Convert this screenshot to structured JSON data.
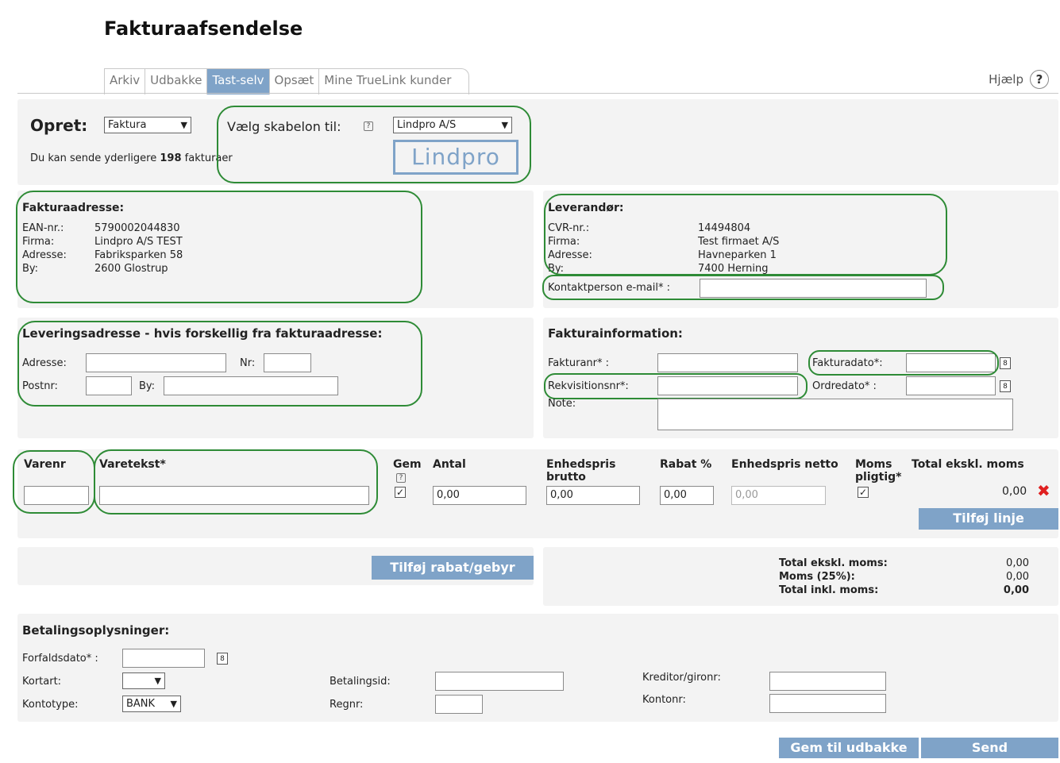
{
  "page": {
    "title": "Fakturaafsendelse"
  },
  "tabs": [
    "Arkiv",
    "Udbakke",
    "Tast-selv",
    "Opsæt",
    "Mine TrueLink kunder"
  ],
  "help": {
    "label": "Hjælp",
    "icon": "?"
  },
  "opret": {
    "label": "Opret:",
    "type_selected": "Faktura",
    "template_label": "Vælg skabelon til:",
    "template_selected": "Lindpro A/S",
    "logo_text": "Lindpro",
    "remaining_prefix": "Du kan sende yderligere",
    "remaining_count": "198",
    "remaining_suffix": "fakturaer"
  },
  "fakturaadresse": {
    "heading": "Fakturaadresse:",
    "rows": [
      {
        "label": "EAN-nr.:",
        "value": "5790002044830"
      },
      {
        "label": "Firma:",
        "value": "Lindpro A/S TEST"
      },
      {
        "label": "Adresse:",
        "value": "Fabriksparken  58"
      },
      {
        "label": "By:",
        "value": "2600   Glostrup"
      }
    ]
  },
  "leverandor": {
    "heading": "Leverandør:",
    "rows": [
      {
        "label": "CVR-nr.:",
        "value": "14494804"
      },
      {
        "label": "Firma:",
        "value": "Test firmaet A/S"
      },
      {
        "label": "Adresse:",
        "value": "Havneparken  1"
      },
      {
        "label": "By:",
        "value": "7400   Herning"
      }
    ],
    "contact_label": "Kontaktperson e-mail* :"
  },
  "leveringsadresse": {
    "heading": "Leveringsadresse - hvis forskellig fra fakturaadresse:",
    "adresse": "Adresse:",
    "nr": "Nr:",
    "postnr": "Postnr:",
    "by": "By:"
  },
  "fakturainformation": {
    "heading": "Fakturainformation:",
    "fakturanr": "Fakturanr* :",
    "fakturadato": "Fakturadato*:",
    "rekvisitionsnr": "Rekvisitionsnr*:",
    "ordredato": "Ordredato* :",
    "note": "Note:"
  },
  "lines": {
    "headers": {
      "varenr": "Varenr",
      "varetekst": "Varetekst*",
      "gem": "Gem",
      "antal": "Antal",
      "enhedspris_brutto_1": "Enhedspris",
      "enhedspris_brutto_2": "brutto",
      "rabat": "Rabat %",
      "enhedspris_netto": "Enhedspris netto",
      "moms_1": "Moms",
      "moms_2": "pligtig*",
      "total": "Total ekskl. moms"
    },
    "row": {
      "antal": "0,00",
      "brutto": "0,00",
      "rabat": "0,00",
      "netto": "0,00",
      "total": "0,00"
    },
    "add_line": "Tilføj linje"
  },
  "discount_button": "Tilføj rabat/gebyr",
  "totals": {
    "labels": [
      "Total ekskl. moms:",
      "Moms (25%):",
      "Total inkl. moms:"
    ],
    "values": [
      "0,00",
      "0,00",
      "0,00"
    ]
  },
  "betaling": {
    "heading": "Betalingsoplysninger:",
    "forfaldsdato": "Forfaldsdato* :",
    "kortart": "Kortart:",
    "kontotype": "Kontotype:",
    "kontotype_selected": "BANK",
    "betalingsid": "Betalingsid:",
    "regnr": "Regnr:",
    "kreditor": "Kreditor/gironr:",
    "kontonr": "Kontonr:"
  },
  "footer": {
    "save": "Gem til udbakke",
    "send": "Send"
  },
  "colors": {
    "accent": "#7fa3c8",
    "ring": "#2e8b36",
    "panel": "#f3f3f3",
    "delete": "#e02020"
  }
}
